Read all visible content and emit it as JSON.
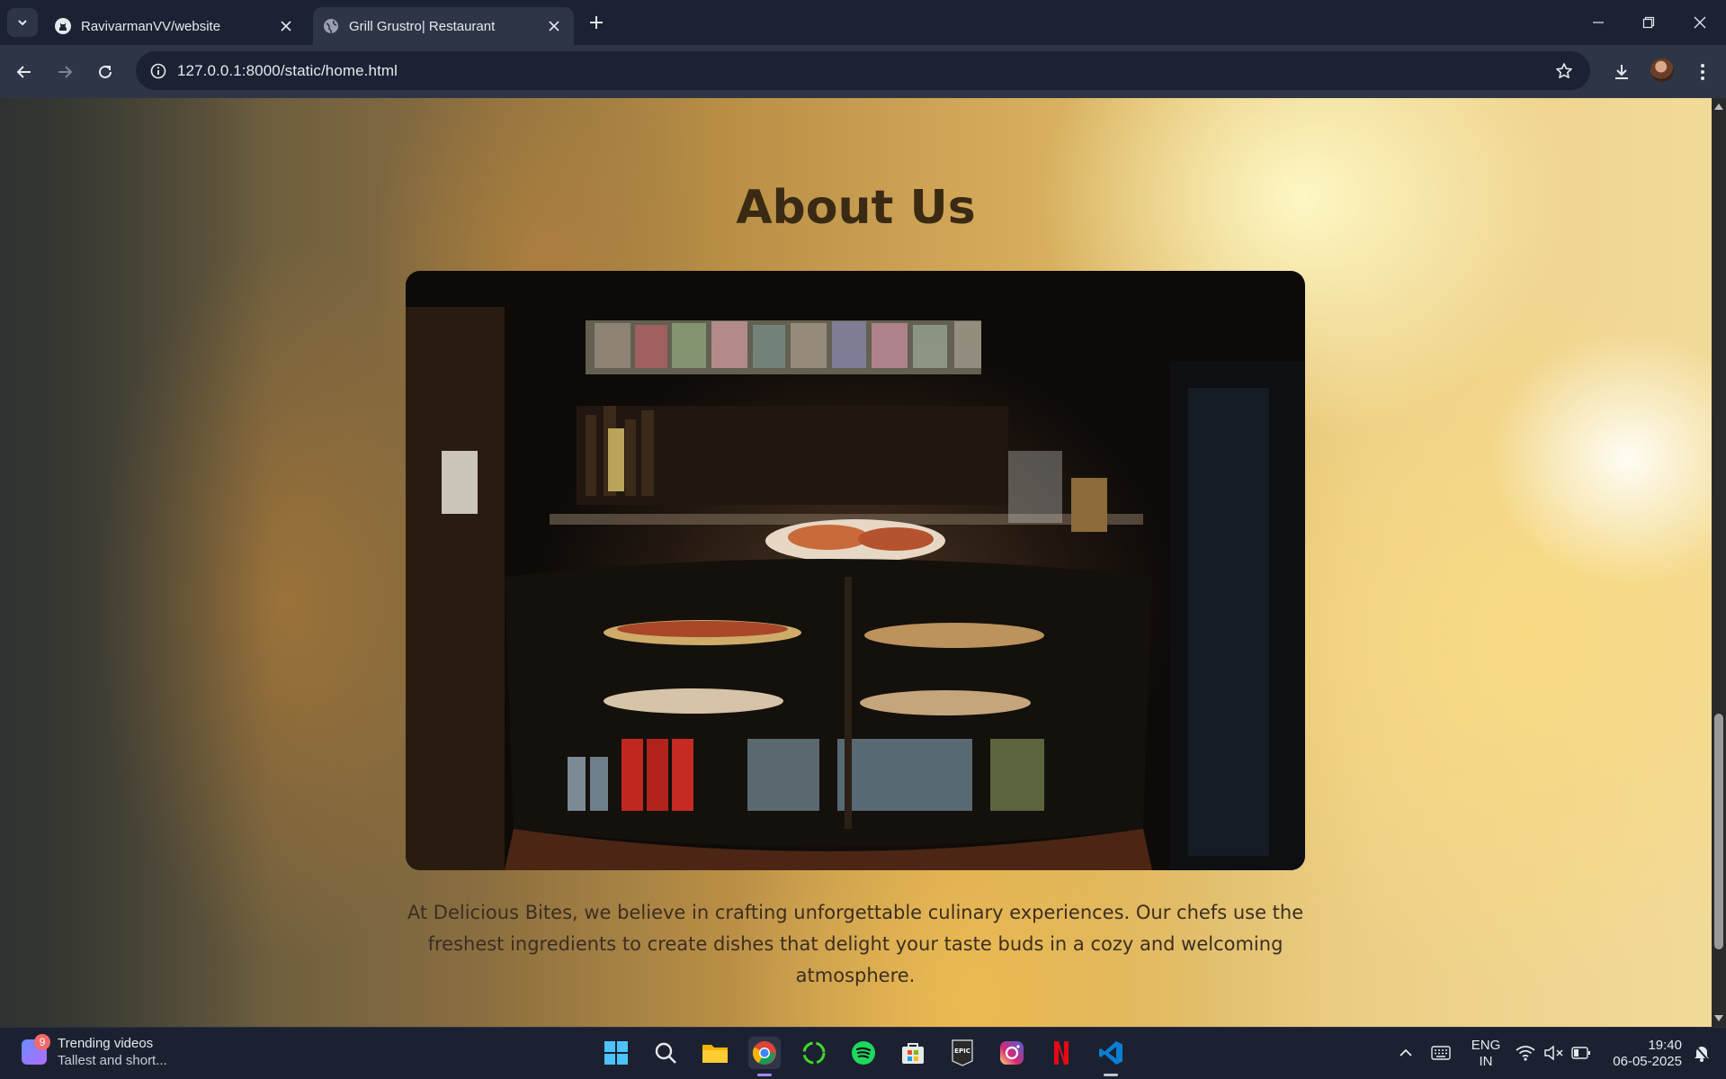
{
  "browser": {
    "tabs": [
      {
        "title": "RavivarmanVV/website",
        "icon": "github-icon",
        "active": false
      },
      {
        "title": "Grill Grustro| Restaurant",
        "icon": "globe-icon",
        "active": true
      }
    ],
    "url": "127.0.0.1:8000/static/home.html"
  },
  "page": {
    "heading": "About Us",
    "image_alt": "Restaurant display counter with pizzas, sandwiches and drinks",
    "description": "At Delicious Bites, we believe in crafting unforgettable culinary experiences. Our chefs use the freshest ingredients to create dishes that delight your taste buds in a cozy and welcoming atmosphere."
  },
  "taskbar": {
    "widget": {
      "badge": "9",
      "title": "Trending videos",
      "subtitle": "Tallest and short..."
    },
    "apps": [
      "windows-start-icon",
      "search-icon",
      "file-explorer-icon",
      "chrome-icon",
      "razer-cortex-icon",
      "spotify-icon",
      "microsoft-store-icon",
      "epic-games-icon",
      "instagram-icon",
      "netflix-icon",
      "vscode-icon"
    ],
    "language": {
      "line1": "ENG",
      "line2": "IN"
    },
    "time": "19:40",
    "date": "06-05-2025"
  },
  "colors": {
    "accent": "#3a2a14",
    "taskbar": "#1b2130",
    "toolbar": "#2e3547"
  }
}
